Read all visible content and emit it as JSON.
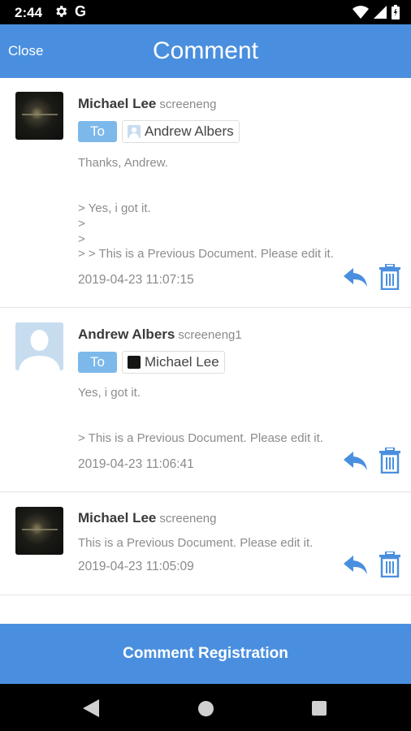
{
  "status_bar": {
    "time": "2:44",
    "g_letter": "G",
    "icons": [
      "gear-icon",
      "google-icon",
      "wifi-icon",
      "signal-icon",
      "battery-icon"
    ]
  },
  "header": {
    "close_label": "Close",
    "title": "Comment"
  },
  "comments": [
    {
      "author": "Michael Lee",
      "user_id": "screeneng",
      "avatar": "dark-photo",
      "to_label": "To",
      "recipient": "Andrew Albers",
      "body": "Thanks, Andrew.\n\n\n> Yes, i got it.\n>\n>\n> > This is a Previous Document. Please edit it.",
      "timestamp": "2019-04-23 11:07:15"
    },
    {
      "author": "Andrew Albers",
      "user_id": "screeneng1",
      "avatar": "person-placeholder",
      "to_label": "To",
      "recipient": "Michael Lee",
      "body": "Yes, i got it.\n\n\n> This is a Previous Document. Please edit it.",
      "timestamp": "2019-04-23 11:06:41"
    },
    {
      "author": "Michael Lee",
      "user_id": "screeneng",
      "avatar": "dark-photo",
      "body": "This is a Previous Document. Please edit it.",
      "timestamp": "2019-04-23 11:05:09"
    }
  ],
  "footer": {
    "register_label": "Comment Registration"
  },
  "colors": {
    "primary": "#4a8fdf",
    "to_badge": "#7cb9ea",
    "icon_blue": "#4a8fdf"
  }
}
